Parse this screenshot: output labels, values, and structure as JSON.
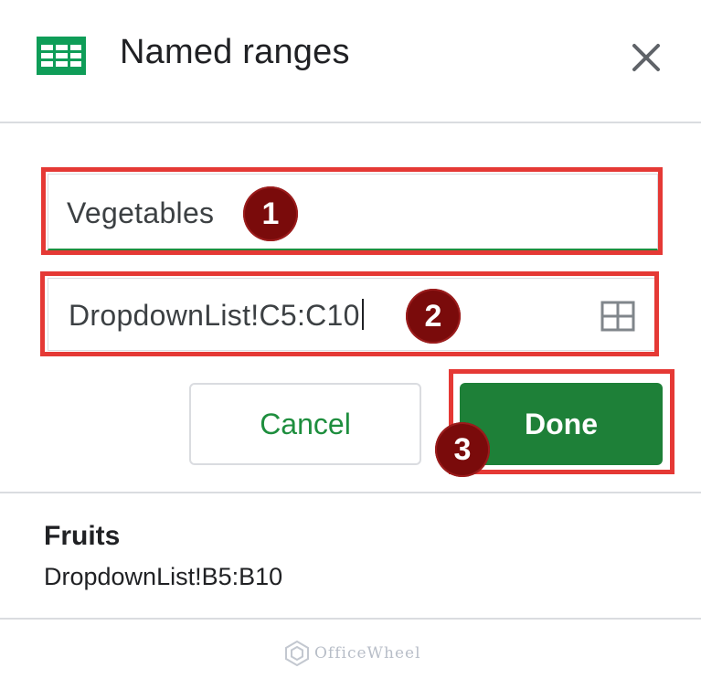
{
  "dialog": {
    "title": "Named ranges",
    "header_icon": "google-sheets-icon",
    "close_icon": "close-icon"
  },
  "form": {
    "name_value": "Vegetables",
    "range_value": "DropdownList!C5:C10",
    "range_icon": "select-data-range-icon",
    "cancel_label": "Cancel",
    "done_label": "Done"
  },
  "annotations": [
    {
      "label": "1"
    },
    {
      "label": "2"
    },
    {
      "label": "3"
    }
  ],
  "named_ranges": [
    {
      "name": "Fruits",
      "range": "DropdownList!B5:B10"
    }
  ],
  "watermark": {
    "text": "OfficeWheel"
  },
  "colors": {
    "accent_green": "#1e8038",
    "annotation_red": "#e53935",
    "badge_maroon": "#7a0b0b"
  }
}
